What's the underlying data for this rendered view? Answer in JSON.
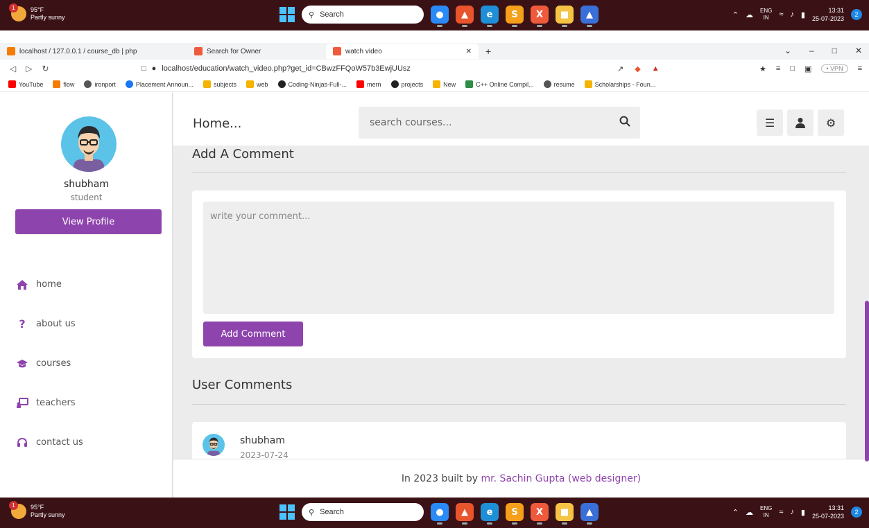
{
  "taskbar": {
    "weather_temp": "95°F",
    "weather_desc": "Partly sunny",
    "weather_badge": "1",
    "search_label": "Search",
    "lang_top": "ENG",
    "lang_bottom": "IN",
    "time": "13:31",
    "date": "25-07-2023",
    "notif_count": "2"
  },
  "browser": {
    "tabs": [
      {
        "label": "localhost / 127.0.0.1 / course_db | php"
      },
      {
        "label": "Search for Owner"
      },
      {
        "label": "watch video"
      }
    ],
    "new_tab": "+",
    "url": "localhost/education/watch_video.php?get_id=CBwzFFQoW57b3EwjUUsz",
    "vpn": "• VPN",
    "bookmarks": [
      {
        "label": "YouTube",
        "color": "#ff0000"
      },
      {
        "label": "flow",
        "color": "#f57c00"
      },
      {
        "label": "ironport",
        "color": "#555555"
      },
      {
        "label": "Placement Announ...",
        "color": "#1877f2"
      },
      {
        "label": "subjects",
        "color": "#f4b400"
      },
      {
        "label": "web",
        "color": "#f4b400"
      },
      {
        "label": "Coding-Ninjas-Full-...",
        "color": "#222222"
      },
      {
        "label": "mern",
        "color": "#ff0000"
      },
      {
        "label": "projects",
        "color": "#222222"
      },
      {
        "label": "New",
        "color": "#f4b400"
      },
      {
        "label": "C++ Online Compil...",
        "color": "#2f8d46"
      },
      {
        "label": "resume",
        "color": "#555555"
      },
      {
        "label": "Scholarships - Foun...",
        "color": "#f4b400"
      }
    ]
  },
  "sidebar": {
    "name": "shubham",
    "role": "student",
    "view_profile": "View Profile",
    "items": [
      {
        "label": "home",
        "icon": "home-icon"
      },
      {
        "label": "about us",
        "icon": "question-icon"
      },
      {
        "label": "courses",
        "icon": "graduation-cap-icon"
      },
      {
        "label": "teachers",
        "icon": "chalkboard-teacher-icon"
      },
      {
        "label": "contact us",
        "icon": "headset-icon"
      }
    ]
  },
  "header": {
    "title": "Home...",
    "search_placeholder": "search courses..."
  },
  "main": {
    "add_comment_heading": "Add A Comment",
    "comment_placeholder": "write your comment...",
    "add_comment_button": "Add Comment",
    "user_comments_heading": "User Comments",
    "comments": [
      {
        "user": "shubham",
        "date": "2023-07-24"
      }
    ]
  },
  "footer": {
    "prefix": "In 2023 built by ",
    "author": "mr. Sachin Gupta (web designer)"
  },
  "colors": {
    "accent": "#8e44ad",
    "taskbar": "#3a1216",
    "page_bg": "#ececec"
  }
}
